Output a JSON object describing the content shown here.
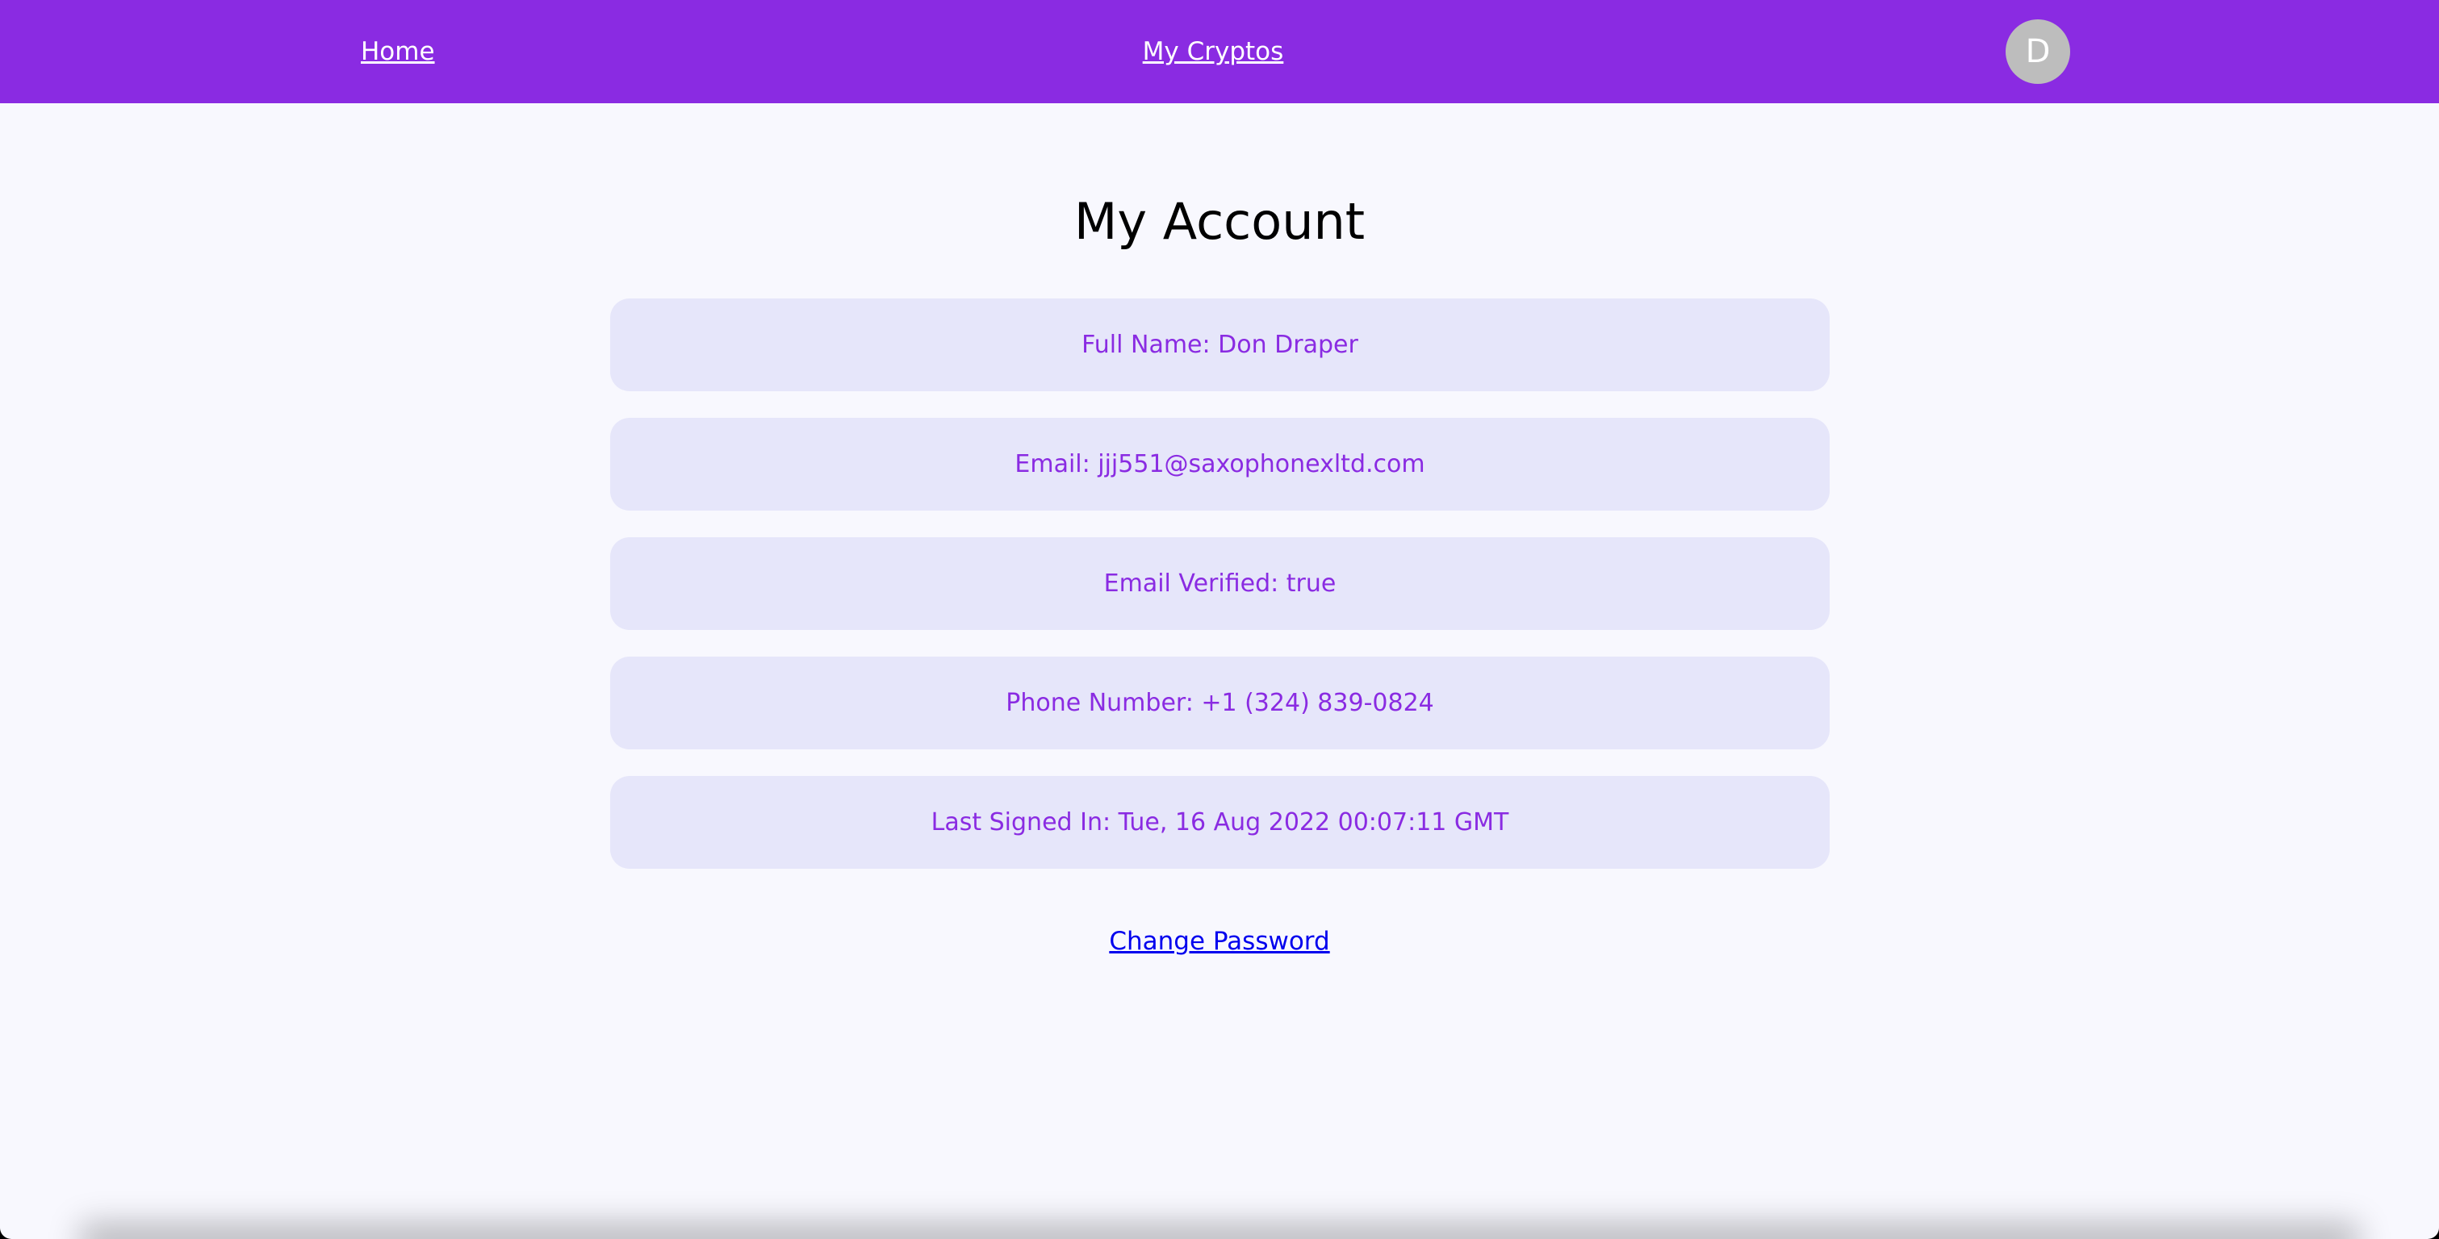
{
  "navbar": {
    "home_label": "Home",
    "cryptos_label": "My Cryptos",
    "avatar_initial": "D"
  },
  "main": {
    "title": "My Account",
    "fields": [
      "Full Name: Don Draper",
      "Email: jjj551@saxophonexltd.com",
      "Email Verified: true",
      "Phone Number: +1 (324) 839-0824",
      "Last Signed In: Tue, 16 Aug 2022 00:07:11 GMT"
    ],
    "change_password_label": "Change Password"
  },
  "colors": {
    "navbar_bg": "#8a2be2",
    "page_bg": "#f8f8fe",
    "card_bg": "#e6e6fa",
    "card_text": "#8a2be2",
    "link": "#0000ee",
    "avatar_bg": "#bdbdbd"
  }
}
